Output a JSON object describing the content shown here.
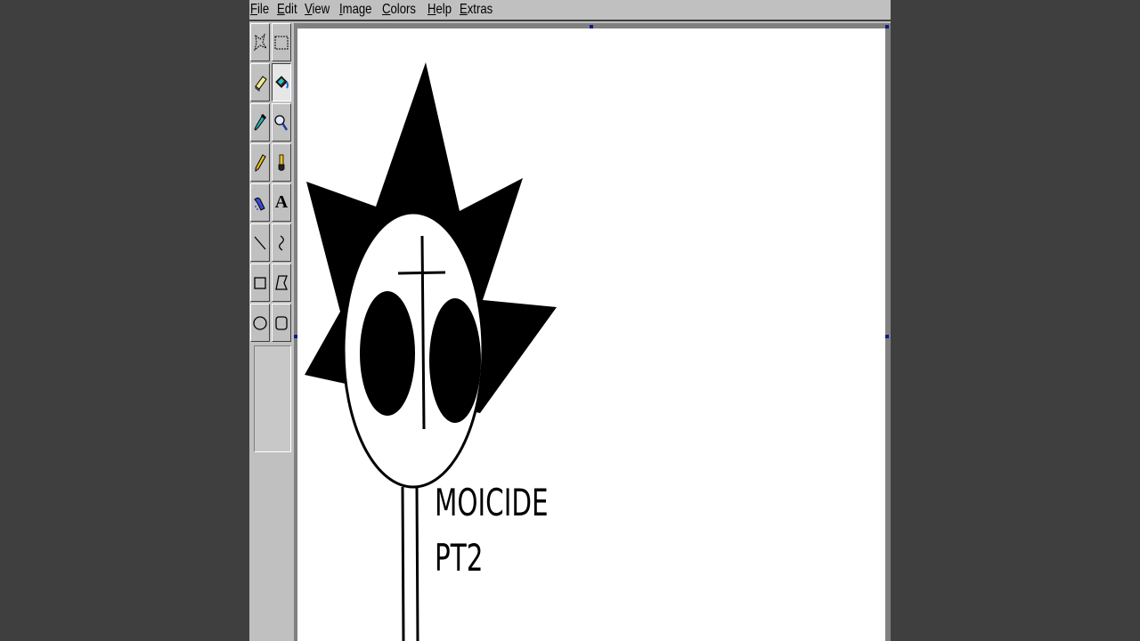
{
  "menu": {
    "file": {
      "hot": "F",
      "rest": "ile"
    },
    "edit": {
      "hot": "E",
      "rest": "dit"
    },
    "view": {
      "hot": "V",
      "rest": "iew"
    },
    "image": {
      "hot": "I",
      "rest": "mage"
    },
    "colors": {
      "hot": "C",
      "rest": "olors"
    },
    "help": {
      "hot": "H",
      "rest": "elp"
    },
    "extras": {
      "hot": "E",
      "rest": "xtras"
    }
  },
  "tools": [
    {
      "name": "free-form-select",
      "icon": "free-select-icon",
      "selected": false
    },
    {
      "name": "rectangle-select",
      "icon": "rect-select-icon",
      "selected": false
    },
    {
      "name": "eraser",
      "icon": "eraser-icon",
      "selected": false
    },
    {
      "name": "fill-bucket",
      "icon": "fill-bucket-icon",
      "selected": true
    },
    {
      "name": "pick-color",
      "icon": "eyedropper-icon",
      "selected": false
    },
    {
      "name": "magnifier",
      "icon": "magnifier-icon",
      "selected": false
    },
    {
      "name": "pencil",
      "icon": "pencil-icon",
      "selected": false
    },
    {
      "name": "brush",
      "icon": "brush-icon",
      "selected": false
    },
    {
      "name": "airbrush",
      "icon": "airbrush-icon",
      "selected": false
    },
    {
      "name": "text",
      "icon": "text-icon",
      "selected": false
    },
    {
      "name": "line",
      "icon": "line-icon",
      "selected": false
    },
    {
      "name": "curve",
      "icon": "curve-icon",
      "selected": false
    },
    {
      "name": "rectangle",
      "icon": "rectangle-icon",
      "selected": false
    },
    {
      "name": "polygon",
      "icon": "polygon-icon",
      "selected": false
    },
    {
      "name": "ellipse",
      "icon": "ellipse-icon",
      "selected": false
    },
    {
      "name": "rounded-rectangle",
      "icon": "rounded-rect-icon",
      "selected": false
    }
  ],
  "text_tool_glyph": "A",
  "canvas": {
    "background": "#ffffff",
    "ink": "#000000",
    "text_line_1": "MOICIDE",
    "text_line_2": "PT2"
  },
  "colors": {
    "desktop": "#3f3f3f",
    "chrome": "#c0c0c0",
    "handle": "#0a1a8c"
  }
}
